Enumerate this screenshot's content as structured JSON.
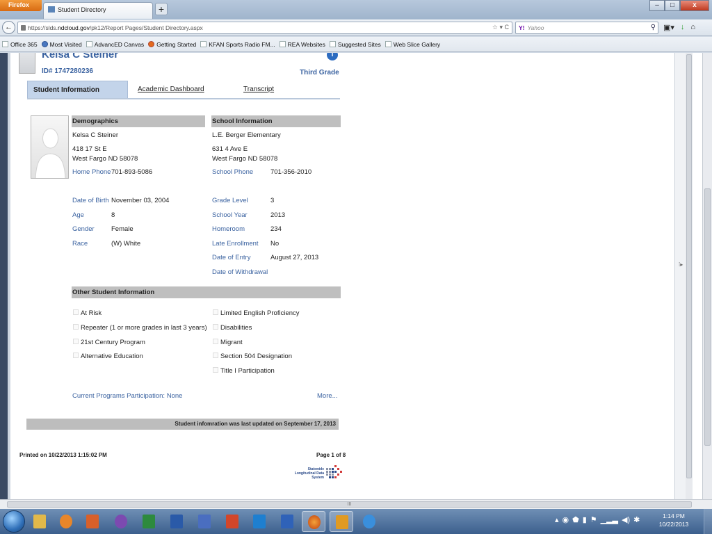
{
  "browser": {
    "app_button": "Firefox",
    "tab_title": "Student Directory",
    "new_tab": "+",
    "url_prefix": "https://slds.",
    "url_domain": "ndcloud.gov",
    "url_path": "/pk12/Report Pages/Student Directory.aspx",
    "url_tools": "☆ ▾ C",
    "search_engine": "Y!",
    "search_placeholder": "Yahoo",
    "bookmarks": [
      "Office 365",
      "Most Visited",
      "AdvancED Canvas",
      "Getting Started",
      "KFAN Sports Radio FM...",
      "REA Websites",
      "Suggested Sites",
      "Web Slice Gallery"
    ]
  },
  "student": {
    "name": "Kelsa C Steiner",
    "id": "ID# 1747280236",
    "grade": "Third Grade"
  },
  "tabs": {
    "student_information": "Student Information",
    "academic_dashboard": "Academic Dashboard",
    "transcript": "Transcript"
  },
  "demographics": {
    "heading": "Demographics",
    "name": "Kelsa C Steiner",
    "address1": "418 17 St E",
    "address2": "West Fargo ND 58078",
    "home_phone_label": "Home Phone",
    "home_phone": "701-893-5086",
    "dob_label": "Date of Birth",
    "dob": "November 03, 2004",
    "age_label": "Age",
    "age": "8",
    "gender_label": "Gender",
    "gender": "Female",
    "race_label": "Race",
    "race": "(W) White"
  },
  "school": {
    "heading": "School Information",
    "name": "L.E. Berger Elementary",
    "address1": "631 4 Ave E",
    "address2": "West Fargo ND 58078",
    "phone_label": "School Phone",
    "phone": "701-356-2010",
    "grade_level_label": "Grade Level",
    "grade_level": "3",
    "school_year_label": "School Year",
    "school_year": "2013",
    "homeroom_label": "Homeroom",
    "homeroom": "234",
    "late_enrollment_label": "Late Enrollment",
    "late_enrollment": "No",
    "date_of_entry_label": "Date of Entry",
    "date_of_entry": "August 27, 2013",
    "date_of_withdrawal_label": "Date of Withdrawal"
  },
  "other": {
    "heading": "Other Student Information",
    "left_items": [
      "At Risk",
      "Repeater (1 or more grades in last 3 years)",
      "21st Century Program",
      "Alternative Education"
    ],
    "right_items": [
      "Limited English Proficiency",
      "Disabilities",
      "Migrant",
      "Section 504 Designation",
      "Title I Participation"
    ],
    "programs": "Current Programs Participation: None",
    "more": "More..."
  },
  "footer": {
    "updated": "Student infomration was last updated on September 17, 2013",
    "printed_on": "Printed on 10/22/2013 1:15:02 PM",
    "page": "Page 1 of 8",
    "logo_text": "Statewide Longitudinal Data System"
  },
  "hscroll_grip": "III",
  "taskbar": {
    "time": "1:14 PM",
    "date": "10/22/2013"
  }
}
